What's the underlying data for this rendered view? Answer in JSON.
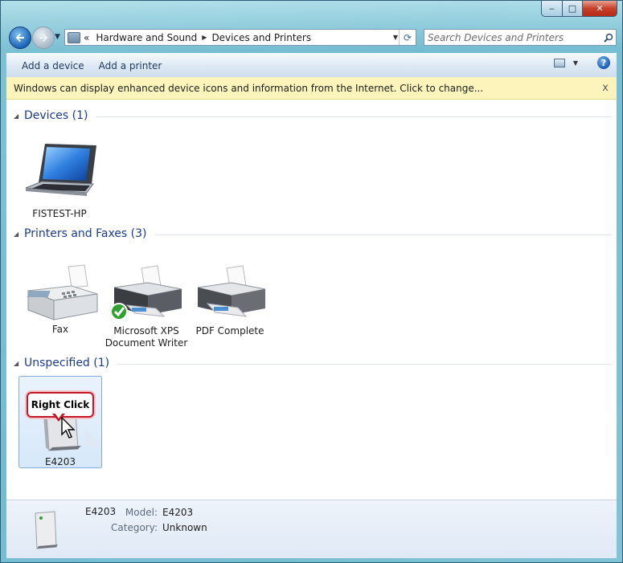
{
  "window": {
    "caption_buttons": {
      "minimize": "‒",
      "maximize": "□",
      "close": "✕"
    }
  },
  "nav": {
    "breadcrumb": [
      "Hardware and Sound",
      "Devices and Printers"
    ],
    "overflow_marker": "«",
    "search_placeholder": "Search Devices and Printers"
  },
  "commandbar": {
    "add_device": "Add a device",
    "add_printer": "Add a printer",
    "help": "?"
  },
  "infobar": {
    "text": "Windows can display enhanced device icons and information from the Internet. Click to change...",
    "close": "x"
  },
  "groups": {
    "devices": {
      "title": "Devices (1)"
    },
    "printers": {
      "title": "Printers and Faxes (3)"
    },
    "unspecified": {
      "title": "Unspecified (1)"
    }
  },
  "items": {
    "laptop": {
      "label": "FISTEST-HP"
    },
    "fax": {
      "label": "Fax"
    },
    "xps": {
      "label_line1": "Microsoft XPS",
      "label_line2": "Document Writer"
    },
    "pdf": {
      "label": "PDF Complete"
    },
    "e4203": {
      "label": "E4203"
    }
  },
  "callout": {
    "text": "Right Click"
  },
  "details": {
    "name": "E4203",
    "model_label": "Model:",
    "model_value": "E4203",
    "category_label": "Category:",
    "category_value": "Unknown"
  },
  "colors": {
    "accent_blue": "#1c3c8a",
    "infobar_bg": "#fcf4ba",
    "callout_border": "#c2182a"
  }
}
